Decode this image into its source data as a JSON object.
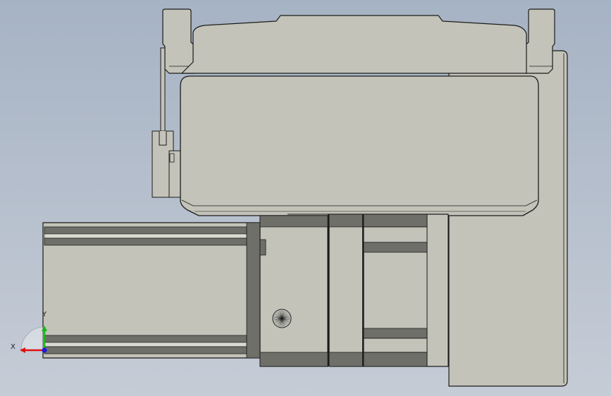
{
  "viewport": {
    "background_top": "#a6b3c4",
    "background_bottom": "#c6ccd6"
  },
  "model": {
    "body_fill": "#c3c3b9",
    "edge_color": "#1b1b1b",
    "shadow_fill": "#6f6f6a",
    "highlight_fill": "#d9d9d1"
  },
  "triad": {
    "x_label": "X",
    "y_label": "Y",
    "x_color": "#e01010",
    "y_color": "#18b818",
    "z_color": "#1a1ae0"
  }
}
